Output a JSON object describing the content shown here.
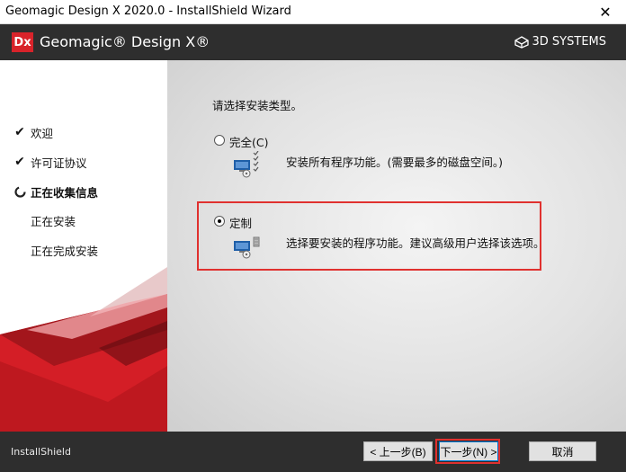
{
  "window": {
    "title": "Geomagic Design X 2020.0 - InstallShield Wizard",
    "close_glyph": "✕"
  },
  "header": {
    "logo_text": "Dx",
    "product_name": "Geomagic® Design X®",
    "brand": "3D SYSTEMS"
  },
  "steps": [
    {
      "label": "欢迎",
      "state": "done"
    },
    {
      "label": "许可证协议",
      "state": "done"
    },
    {
      "label": "正在收集信息",
      "state": "current"
    },
    {
      "label": "正在安装",
      "state": "pending"
    },
    {
      "label": "正在完成安装",
      "state": "pending"
    }
  ],
  "main": {
    "prompt": "请选择安装类型。",
    "options": [
      {
        "label": "完全(C)",
        "selected": false,
        "description": "安装所有程序功能。(需要最多的磁盘空间。)"
      },
      {
        "label": "定制",
        "selected": true,
        "description": "选择要安装的程序功能。建议高级用户选择该选项。"
      }
    ]
  },
  "footer": {
    "brand": "InstallShield",
    "back_label": "< 上一步(B)",
    "next_label": "下一步(N) >",
    "cancel_label": "取消"
  },
  "colors": {
    "header_bg": "#2e2e2e",
    "accent_red": "#d8232a",
    "highlight_red": "#e0312f"
  }
}
